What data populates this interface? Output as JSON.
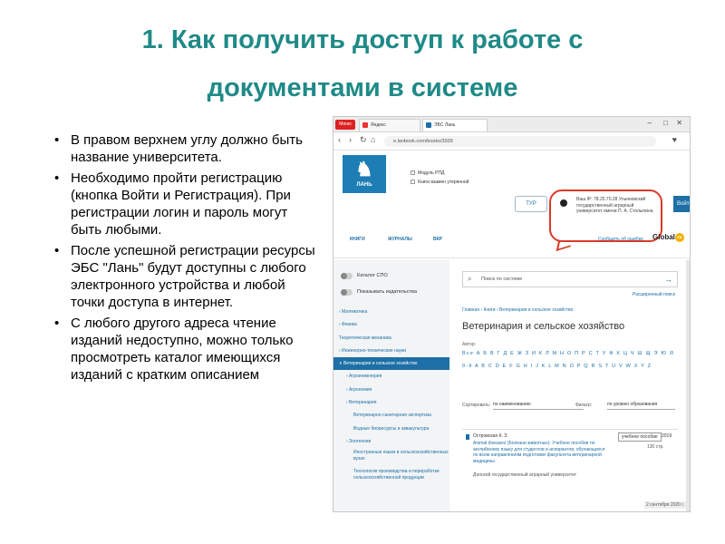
{
  "slide": {
    "title": "1. Как получить доступ к работе с документами в системе",
    "bullets": [
      "В  правом верхнем углу должно быть название университета.",
      "Необходимо пройти регистрацию (кнопка Войти и Регистрация). При регистрации логин и пароль могут быть любыми.",
      "После успешной регистрации ресурсы ЭБС \"Лань\" будут доступны с любого электронного устройства и любой точки доступа в интернет.",
      "С любого другого адреса чтение изданий недоступно, можно только просмотреть каталог имеющихся изданий с кратким описанием"
    ]
  },
  "browser": {
    "menu_label": "Меню",
    "tabs": [
      "Яндекс",
      "ЭБС Лань"
    ],
    "url": "e.lanbook.com/books/3939",
    "nav_icons": [
      "back-icon",
      "forward-icon",
      "reload-icon",
      "home-icon"
    ]
  },
  "site": {
    "logo_text": "ЛАНЬ",
    "modules": [
      "Модуль РПД",
      "Книга взамен утерянной"
    ],
    "tour_button": "ТУР",
    "login_button": "Войти",
    "university": "Ваш IP: 78.25.70.28 Ульяновский государственный аграрный университет имени П. А. Столыпина",
    "menu": [
      "КНИГИ",
      "ЖУРНАЛЫ",
      "ВКР"
    ],
    "feedback": "Сообщить об ошибке",
    "global_label": "Global",
    "global_badge": "F5"
  },
  "sidebar": {
    "toggles": [
      "Каталог СПО",
      "Показывать издательства"
    ],
    "items": [
      {
        "label": "› Математика",
        "level": 0
      },
      {
        "label": "› Физика",
        "level": 0
      },
      {
        "label": "Теоретическая механика",
        "level": 0
      },
      {
        "label": "› Инженерно-технические науки",
        "level": 0
      },
      {
        "label": "∨ Ветеринария и сельское хозяйство",
        "level": 0,
        "active": true
      },
      {
        "label": "› Агроинженерия",
        "level": 1
      },
      {
        "label": "› Агрономия",
        "level": 1
      },
      {
        "label": "› Ветеринария",
        "level": 1
      },
      {
        "label": "Ветеринарно-санитарная экспертиза",
        "level": 2
      },
      {
        "label": "Водные биоресурсы и аквакультура",
        "level": 2
      },
      {
        "label": "› Зоотехния",
        "level": 1
      },
      {
        "label": "Иностранные языки в сельскохозяйственных вузах",
        "level": 2,
        "multi": true
      },
      {
        "label": "Технология производства и переработки сельскохозяйственной продукции",
        "level": 2,
        "multi": true
      }
    ]
  },
  "main": {
    "search_placeholder": "Поиск по системе",
    "advanced_search": "Расширенный поиск",
    "breadcrumb": "Главная › Книги › Ветеринария и сельское хозяйство",
    "section_title": "Ветеринария и сельское хозяйство",
    "author_label": "Автор:",
    "alphabet_ru": "Все А Б В Г Д Е Ж З И К Л М Н О П Р С Т У Ф Х Ц Ч Ш Щ Э Ю Я",
    "alphabet_en": "0-9 A B C D E F G H I J K L M N O P Q R S T U V W X Y Z",
    "sort_label": "Сортировать:",
    "sort_value": "по наименованию",
    "filter_label": "Фильтр:",
    "filter_value": "по уровню образования",
    "book": {
      "author": "Островская К. З.",
      "description": "Animal diseases (Болезни животных): Учебное пособие по английскому языку для студентов и аспирантов, обучающихся по всем направлениям подготовки факультета ветеринарной медицины",
      "publisher": "Донской государственный аграрный университет",
      "badge": "учебное пособие",
      "year": "2019",
      "pages": "130 стр."
    },
    "datestamp": "2 сентября 2020 г."
  }
}
